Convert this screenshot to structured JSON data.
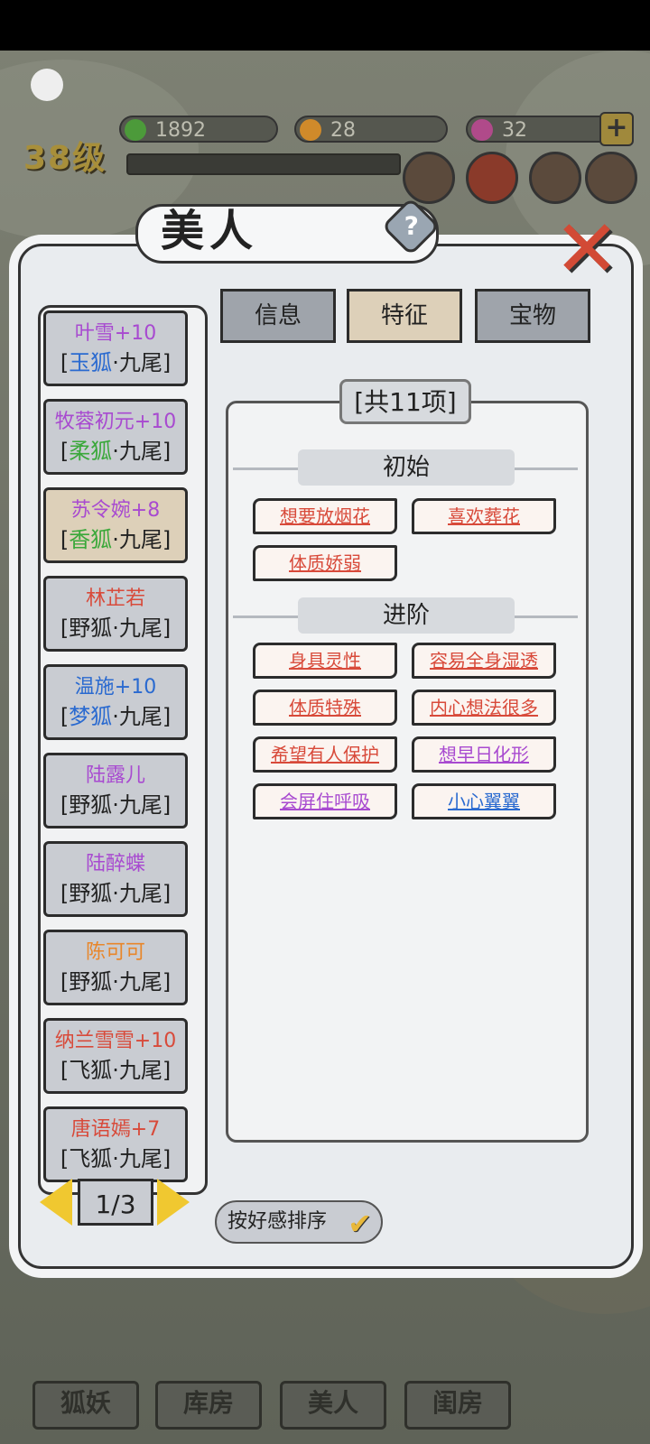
{
  "hud": {
    "resources": [
      {
        "icon": "leaf-icon",
        "value": "1892",
        "color": "#4c9a3a"
      },
      {
        "icon": "moon-icon",
        "value": "28",
        "color": "#d08a2a"
      },
      {
        "icon": "gem-icon",
        "value": "32",
        "color": "#b04a8a"
      }
    ],
    "level": "38级",
    "plus_label": "+"
  },
  "dialog": {
    "title": "美人",
    "help_label": "?",
    "close_label": "✕",
    "tabs": [
      {
        "label": "信息",
        "active": false
      },
      {
        "label": "特征",
        "active": true
      },
      {
        "label": "宝物",
        "active": false
      }
    ],
    "count_label": "[共11项]",
    "sections": {
      "initial": {
        "title": "初始",
        "traits": [
          {
            "label": "想要放烟花",
            "color": "#d84a3a"
          },
          {
            "label": "喜欢葬花",
            "color": "#d84a3a"
          },
          {
            "label": "体质娇弱",
            "color": "#d84a3a"
          }
        ]
      },
      "advanced": {
        "title": "进阶",
        "traits": [
          {
            "label": "身具灵性",
            "color": "#d84a3a"
          },
          {
            "label": "容易全身湿透",
            "color": "#d84a3a"
          },
          {
            "label": "体质特殊",
            "color": "#d84a3a"
          },
          {
            "label": "内心想法很多",
            "color": "#d84a3a"
          },
          {
            "label": "希望有人保护",
            "color": "#d84a3a"
          },
          {
            "label": "想早日化形",
            "color": "#a84ad0"
          },
          {
            "label": "会屏住呼吸",
            "color": "#a84ad0"
          },
          {
            "label": "小心翼翼",
            "color": "#2a6ad0"
          }
        ]
      }
    }
  },
  "beauties": [
    {
      "name": "叶雪+10",
      "name_color": "#a84ad0",
      "lb": "[",
      "fox": "玉狐",
      "fox_color": "#2a6ad0",
      "tail": "·九尾]",
      "selected": false
    },
    {
      "name": "牧蓉初元+10",
      "name_color": "#a84ad0",
      "lb": "[",
      "fox": "柔狐",
      "fox_color": "#3aa83a",
      "tail": "·九尾]",
      "selected": false
    },
    {
      "name": "苏令婉+8",
      "name_color": "#a84ad0",
      "lb": "[",
      "fox": "香狐",
      "fox_color": "#3aa83a",
      "tail": "·九尾]",
      "selected": true
    },
    {
      "name": "林芷若",
      "name_color": "#d84a3a",
      "lb": "[",
      "fox": "野狐",
      "fox_color": "#222222",
      "tail": "·九尾]",
      "selected": false
    },
    {
      "name": "温施+10",
      "name_color": "#2a6ad0",
      "lb": "[",
      "fox": "梦狐",
      "fox_color": "#2a6ad0",
      "tail": "·九尾]",
      "selected": false
    },
    {
      "name": "陆露儿",
      "name_color": "#a84ad0",
      "lb": "[",
      "fox": "野狐",
      "fox_color": "#222222",
      "tail": "·九尾]",
      "selected": false
    },
    {
      "name": "陆醉蝶",
      "name_color": "#a84ad0",
      "lb": "[",
      "fox": "野狐",
      "fox_color": "#222222",
      "tail": "·九尾]",
      "selected": false
    },
    {
      "name": "陈可可",
      "name_color": "#e8862a",
      "lb": "[",
      "fox": "野狐",
      "fox_color": "#222222",
      "tail": "·九尾]",
      "selected": false
    },
    {
      "name": "纳兰雪雪+10",
      "name_color": "#d84a3a",
      "lb": "[",
      "fox": "飞狐",
      "fox_color": "#222222",
      "tail": "·九尾]",
      "selected": false
    },
    {
      "name": "唐语嫣+7",
      "name_color": "#d84a3a",
      "lb": "[",
      "fox": "飞狐",
      "fox_color": "#222222",
      "tail": "·九尾]",
      "selected": false
    }
  ],
  "pager": {
    "label": "1/3"
  },
  "sort": {
    "label": "按好感排序",
    "check": "✔"
  },
  "bottom_nav": [
    {
      "label": "狐妖"
    },
    {
      "label": "库房"
    },
    {
      "label": "美人"
    },
    {
      "label": "闺房"
    }
  ]
}
